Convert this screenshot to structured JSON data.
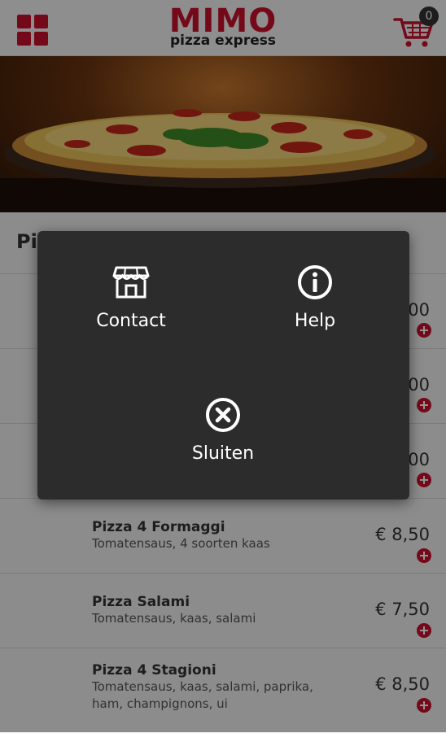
{
  "header": {
    "logo_title": "MIMO",
    "logo_subtitle": "pizza express",
    "cart_count": "0",
    "menu_icon": "grid-menu-icon",
    "cart_icon": "shopping-cart-icon"
  },
  "menu_section": {
    "title": "Pi"
  },
  "prices_behind_modal": [
    ".00",
    ".00",
    ".00"
  ],
  "menu_items": [
    {
      "name": "Pizza 4 Formaggi",
      "description": "Tomatensaus, 4 soorten kaas",
      "price": "€ 8,50"
    },
    {
      "name": "Pizza Salami",
      "description": "Tomatensaus, kaas, salami",
      "price": "€ 7,50"
    },
    {
      "name": "Pizza 4 Stagioni",
      "description": "Tomatensaus, kaas, salami, paprika, ham, champignons, ui",
      "price": "€ 8,50"
    }
  ],
  "modal": {
    "contact_label": "Contact",
    "help_label": "Help",
    "close_label": "Sluiten",
    "contact_icon": "store-icon",
    "help_icon": "info-icon",
    "close_icon": "close-circle-icon"
  },
  "colors": {
    "brand_red": "#c8102e",
    "modal_bg": "#2c2c2c"
  }
}
